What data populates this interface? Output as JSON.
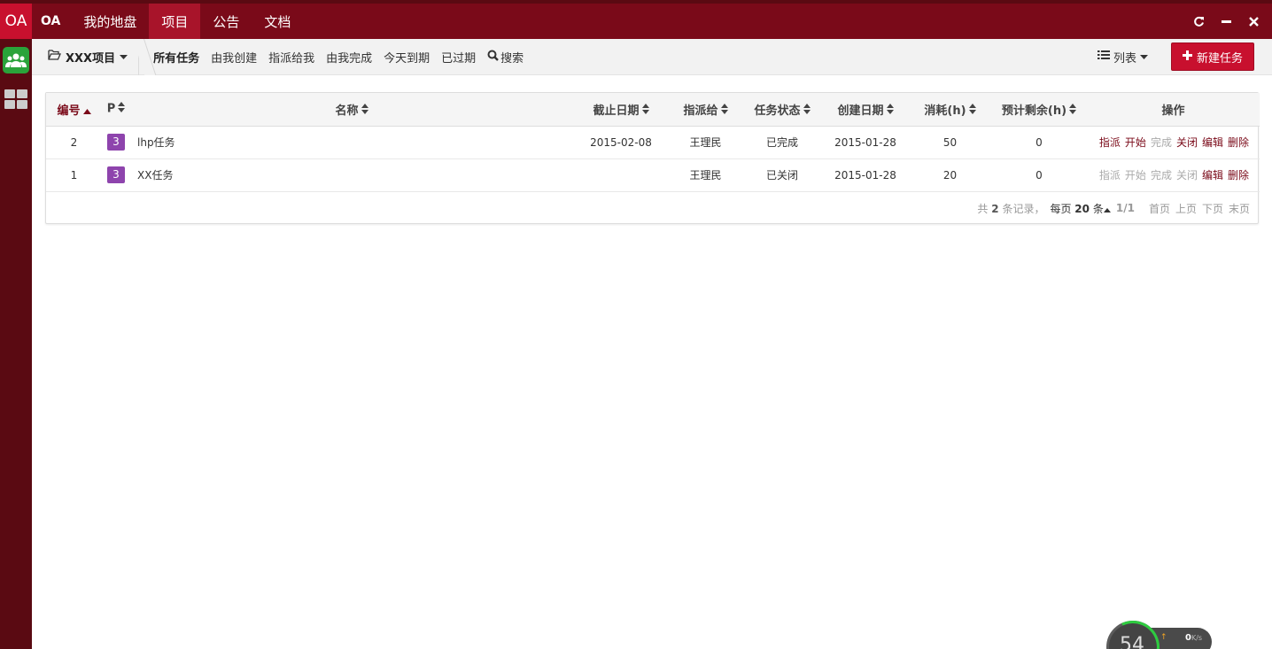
{
  "app": {
    "logo": "OA",
    "brand": "OA"
  },
  "topnav": [
    {
      "label": "我的地盘",
      "active": false
    },
    {
      "label": "项目",
      "active": true
    },
    {
      "label": "公告",
      "active": false
    },
    {
      "label": "文档",
      "active": false
    }
  ],
  "window_controls": [
    "refresh-icon",
    "minimize-icon",
    "close-icon"
  ],
  "toolbar": {
    "project": "XXX项目",
    "filters": [
      "所有任务",
      "由我创建",
      "指派给我",
      "由我完成",
      "今天到期",
      "已过期"
    ],
    "active_filter": "所有任务",
    "search_label": "搜索",
    "view_label": "列表",
    "new_task_label": "新建任务"
  },
  "table": {
    "columns": [
      "编号",
      "P",
      "名称",
      "截止日期",
      "指派给",
      "任务状态",
      "创建日期",
      "消耗(h)",
      "预计剩余(h)",
      "操作"
    ],
    "sorted_column": "编号",
    "rows": [
      {
        "id": "2",
        "priority": "3",
        "name": "lhp任务",
        "deadline": "2015-02-08",
        "assignee": "王理民",
        "status": "已完成",
        "created": "2015-01-28",
        "consumed": "50",
        "left": "0",
        "actions": [
          {
            "label": "指派",
            "enabled": true
          },
          {
            "label": "开始",
            "enabled": true
          },
          {
            "label": "完成",
            "enabled": false
          },
          {
            "label": "关闭",
            "enabled": true
          },
          {
            "label": "编辑",
            "enabled": true
          },
          {
            "label": "删除",
            "enabled": true
          }
        ]
      },
      {
        "id": "1",
        "priority": "3",
        "name": "XX任务",
        "deadline": "",
        "assignee": "王理民",
        "status": "已关闭",
        "created": "2015-01-28",
        "consumed": "20",
        "left": "0",
        "actions": [
          {
            "label": "指派",
            "enabled": false
          },
          {
            "label": "开始",
            "enabled": false
          },
          {
            "label": "完成",
            "enabled": false
          },
          {
            "label": "关闭",
            "enabled": false
          },
          {
            "label": "编辑",
            "enabled": true
          },
          {
            "label": "删除",
            "enabled": true
          }
        ]
      }
    ]
  },
  "pager": {
    "total_prefix": "共",
    "total": "2",
    "total_suffix": "条记录，",
    "per_page_prefix": "每页",
    "per_page": "20",
    "per_page_suffix": "条",
    "page": "1/1",
    "first": "首页",
    "prev": "上页",
    "next": "下页",
    "last": "末页"
  },
  "speed_widget": {
    "value": "54",
    "net_rate": "0",
    "net_unit": "K/s"
  },
  "colors": {
    "topbar": "#7a0a19",
    "active_tab": "#a8142a",
    "accent": "#c8102e",
    "sidebar": "#5a0a12",
    "priority_badge": "#8e44ad"
  }
}
